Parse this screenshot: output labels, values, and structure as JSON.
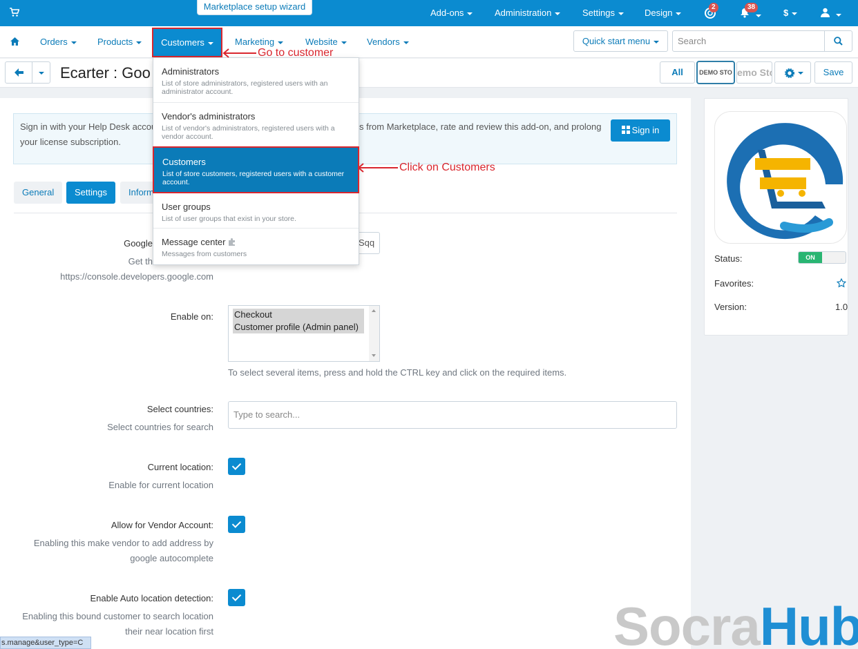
{
  "topbar": {
    "wizard_tab": "Marketplace setup wizard",
    "items": [
      {
        "label": "Add-ons"
      },
      {
        "label": "Administration"
      },
      {
        "label": "Settings"
      },
      {
        "label": "Design"
      }
    ],
    "help_badge": "2",
    "notifications_badge": "38",
    "currency": "$",
    "icons": [
      "cart-icon",
      "help-icon",
      "bell-icon",
      "user-icon"
    ]
  },
  "nav": {
    "items": [
      {
        "label": "Orders"
      },
      {
        "label": "Products"
      },
      {
        "label": "Customers"
      },
      {
        "label": "Marketing"
      },
      {
        "label": "Website"
      },
      {
        "label": "Vendors"
      }
    ],
    "quick_start": "Quick start menu",
    "search_placeholder": "Search"
  },
  "titlebar": {
    "title": "Ecarter : Goo",
    "all_label": "All",
    "demo_label_1": "DEMO STO",
    "demo_label_2": "emo Sto",
    "save_label": "Save"
  },
  "helpdesk": {
    "text_line1_left": "Sign in with your Help Desk accou",
    "text_line1_right": "s from Marketplace, rate and review this add-on, and prolong",
    "text_line2": "your license subscription.",
    "signin_label": "Sign in"
  },
  "tabs": [
    {
      "label": "General"
    },
    {
      "label": "Settings"
    },
    {
      "label": "Inform"
    }
  ],
  "settings": {
    "google_label": "Google",
    "google_hint_1": "Get th",
    "google_hint_2": "https://console.developers.google.com",
    "api_key_tail": "Sqq",
    "enable_on_label": "Enable on:",
    "enable_on_options": [
      "Checkout",
      "Customer profile (Admin panel)"
    ],
    "enable_on_hint": "To select several items, press and hold the CTRL key and click on the required items.",
    "countries_label": "Select countries:",
    "countries_hint": "Select countries for search",
    "countries_placeholder": "Type to search...",
    "current_location_label": "Current location:",
    "current_location_hint": "Enable for current location",
    "vendor_label": "Allow for Vendor Account:",
    "vendor_hint_1": "Enabling this make vendor to add address by",
    "vendor_hint_2": "google autocomplete",
    "auto_label": "Enable Auto location detection:",
    "auto_hint_1": "Enabling this bound customer to search location",
    "auto_hint_2": "their near location first"
  },
  "dropdown": {
    "items": [
      {
        "title": "Administrators",
        "desc": "List of store administrators, registered users with an administrator account."
      },
      {
        "title": "Vendor's administrators",
        "desc": "List of vendor's administrators, registered users with a vendor account."
      },
      {
        "title": "Customers",
        "desc": "List of store customers, registered users with a customer account."
      },
      {
        "title": "User groups",
        "desc": "List of user groups that exist in your store."
      },
      {
        "title": "Message center",
        "desc": "Messages from customers"
      }
    ]
  },
  "annotations": {
    "go_to": "Go to customer",
    "click_on": "Click on Customers",
    "color": "#d9262e"
  },
  "sidebar": {
    "status_label": "Status:",
    "status_value": "ON",
    "favorites_label": "Favorites:",
    "version_label": "Version:",
    "version_value": "1.0"
  },
  "status_url": "s.manage&user_type=C",
  "watermark": {
    "part1": "Socra",
    "part2": "Hub"
  },
  "colors": {
    "accent": "#0b8bd0",
    "annotation": "#d9262e"
  }
}
